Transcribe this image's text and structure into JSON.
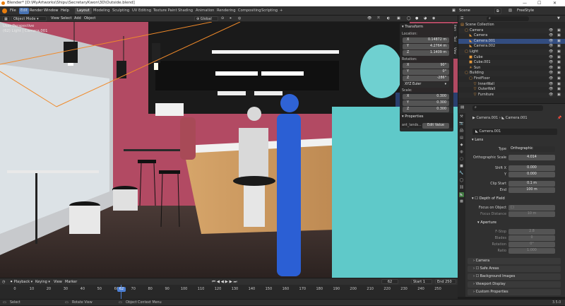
{
  "titlebar": {
    "title": "Blender* [D:\\MyArtworks\\Shipu\\SecretaryKwon\\3D\\Outside.blend]",
    "minimize": "—",
    "maximize": "☐",
    "close": "✕"
  },
  "menu": {
    "file": "File",
    "edit": "Edit",
    "render": "Render",
    "window": "Window",
    "help": "Help"
  },
  "workspaces": [
    "Layout",
    "Modeling",
    "Sculpting",
    "UV Editing",
    "Texture Paint",
    "Shading",
    "Animation",
    "Rendering",
    "Compositing",
    "Scripting"
  ],
  "scene": {
    "label": "Scene",
    "view_layer": "FreeStyle"
  },
  "header3d": {
    "mode": "Object Mode",
    "view": "View",
    "select": "Select",
    "add": "Add",
    "object": "Object",
    "orientation": "Global"
  },
  "viewport": {
    "perspective": "User Perspective",
    "active": "(62) Light | Camera.001"
  },
  "npanel": {
    "title": "Transform",
    "location_label": "Location:",
    "rotation_label": "Rotation:",
    "scale_label": "Scale:",
    "location": [
      {
        "k": "X",
        "v": "0.14872 m"
      },
      {
        "k": "Y",
        "v": "4.2764 m"
      },
      {
        "k": "Z",
        "v": "1.1409 m"
      }
    ],
    "rotation": [
      {
        "k": "X",
        "v": "90°"
      },
      {
        "k": "Y",
        "v": "0°"
      },
      {
        "k": "Z",
        "v": "-286°"
      }
    ],
    "rotation_mode": "XYZ Euler",
    "scale": [
      {
        "k": "X",
        "v": "0.300"
      },
      {
        "k": "Y",
        "v": "0.300"
      },
      {
        "k": "Z",
        "v": "0.300"
      }
    ],
    "properties_title": "Properties",
    "prop_name": "ant_lands...",
    "prop_button": "Edit Value",
    "tabs": [
      "Item",
      "Tool",
      "View"
    ]
  },
  "outliner": {
    "rows": [
      {
        "name": "Scene Collection",
        "indent": 0
      },
      {
        "name": "Camera",
        "indent": 1
      },
      {
        "name": "Camera",
        "indent": 2
      },
      {
        "name": "Camera.001",
        "indent": 2
      },
      {
        "name": "Camera.002",
        "indent": 2
      },
      {
        "name": "Light",
        "indent": 1
      },
      {
        "name": "Cube",
        "indent": 2
      },
      {
        "name": "Cube.001",
        "indent": 2
      },
      {
        "name": "Sun",
        "indent": 2
      },
      {
        "name": "Building",
        "indent": 1
      },
      {
        "name": "FirstFloor",
        "indent": 2
      },
      {
        "name": "InnerWall",
        "indent": 3
      },
      {
        "name": "OuterWall",
        "indent": 3
      },
      {
        "name": "Furniture",
        "indent": 3
      }
    ]
  },
  "properties": {
    "breadcrumb_a": "Camera.001",
    "breadcrumb_b": "Camera.001",
    "datablock": "Camera.001",
    "lens_section": "Lens",
    "fields": [
      {
        "label": "Type",
        "value": "Orthographic"
      },
      {
        "label": "Orthographic Scale",
        "value": "4.014"
      },
      {
        "label": "Shift X",
        "value": "0.000"
      },
      {
        "label": "Y",
        "value": "0.000"
      },
      {
        "label": "Clip Start",
        "value": "0.1 m"
      },
      {
        "label": "End",
        "value": "100 m"
      }
    ],
    "dof": "Depth of Field",
    "focus_object": "Focus on Object",
    "focus_distance": "Focus Distance",
    "focus_distance_val": "10 m",
    "aperture": "Aperture",
    "fstop": "F-Stop",
    "fstop_val": "2.8",
    "blades": "Blades",
    "blades_val": "0",
    "rotation": "Rotation",
    "rotation_val": "0°",
    "ratio": "Ratio",
    "ratio_val": "1.000",
    "sections": [
      "Camera",
      "Safe Areas",
      "Background Images",
      "Viewport Display",
      "Custom Properties"
    ]
  },
  "timeline": {
    "playback": "Playback",
    "keying": "Keying",
    "view": "View",
    "marker": "Marker",
    "current": "62",
    "start_label": "Start",
    "start": "1",
    "end_label": "End",
    "end": "250",
    "ticks": [
      "0",
      "10",
      "30",
      "50",
      "70",
      "90",
      "110",
      "130",
      "150",
      "170",
      "190",
      "210",
      "230",
      "250"
    ],
    "ticks2": [
      "20",
      "40",
      "60",
      "80",
      "100",
      "120",
      "140",
      "160",
      "180",
      "200",
      "220",
      "240"
    ]
  },
  "status": {
    "select": "Select",
    "rotate": "Rotate View",
    "context": "Object Context Menu",
    "version": "3.5.0"
  }
}
